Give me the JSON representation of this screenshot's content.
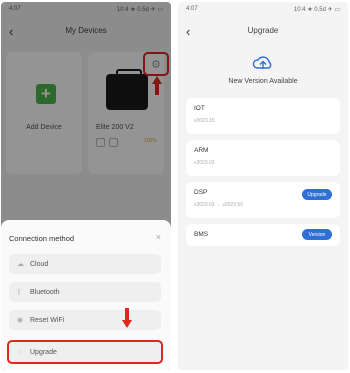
{
  "left_screen": {
    "status_time": "4:07",
    "status_right": "10:4 ★ 0.5d ✈ ▭",
    "title": "My Devices",
    "add_device_label": "Add Device",
    "device": {
      "name": "Elite 200 V2",
      "battery": "100%"
    },
    "sheet": {
      "title": "Connection method",
      "close": "×",
      "options": [
        {
          "label": "Cloud",
          "icon": "cloud-icon"
        },
        {
          "label": "Bluetooth",
          "icon": "bluetooth-icon"
        },
        {
          "label": "Reset WiFi",
          "icon": "wifi-icon"
        },
        {
          "label": "Upgrade",
          "icon": "upgrade-icon"
        }
      ]
    }
  },
  "right_screen": {
    "status_time": "4:07",
    "status_right": "10:4 ★ 0.5d ✈ ▭",
    "title": "Upgrade",
    "available_text": "New Version Available",
    "firmware": [
      {
        "name": "IOT",
        "version": "v2023.15",
        "button": ""
      },
      {
        "name": "ARM",
        "version": "v2023.03",
        "button": ""
      },
      {
        "name": "DSP",
        "version": "v2023.03 → v2023.50",
        "button": "Upgrade"
      },
      {
        "name": "BMS",
        "version": "",
        "button": "Version"
      }
    ]
  },
  "colors": {
    "highlight": "#e0261d",
    "accent": "#2f6fd6",
    "add": "#4fb54f"
  }
}
